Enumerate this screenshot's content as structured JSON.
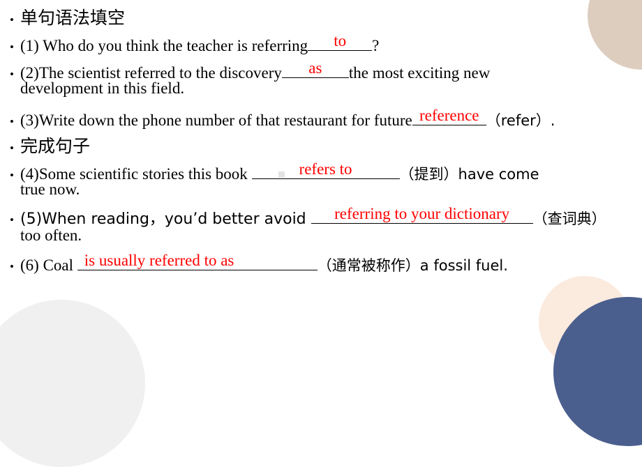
{
  "slide": {
    "background_color": "#ffffff",
    "answer_color": "#ff0000",
    "text_color": "#000000"
  },
  "decorations": [
    {
      "name": "circle-topright",
      "color": "#ddcdbf"
    },
    {
      "name": "circle-bottomleft",
      "color": "#f0f0f0"
    },
    {
      "name": "circle-peach",
      "color": "#fbeade"
    },
    {
      "name": "circle-navy",
      "color": "#4a5f8e"
    }
  ],
  "sections": {
    "heading1": "单句语法填空",
    "heading2": "完成句子"
  },
  "items": {
    "q1": {
      "number": "(1)",
      "text_before": " Who do you think the teacher is referring",
      "answer": "to",
      "text_after": "?"
    },
    "q2": {
      "number": "(2)",
      "text_before": "The scientist referred to the discovery",
      "answer": "as",
      "text_after": "the most exciting new",
      "line2": "development in this field."
    },
    "q3": {
      "number": "(3)",
      "text_before": "Write down the phone number of that restaurant for future",
      "answer": "reference",
      "text_after": "（refer）."
    },
    "q4": {
      "number": "(4)",
      "text_before": "Some scientific stories this book ",
      "answer": "refers to",
      "text_after": "（提到）have come",
      "line2": "true now."
    },
    "q5": {
      "number": "(5)",
      "text_before": "When reading，you’d better avoid ",
      "answer": "referring to your dictionary",
      "text_after": "（查词典）",
      "line2": "too often."
    },
    "q6": {
      "number": "(6)",
      "text_before": " Coal ",
      "answer": "is usually referred to as",
      "text_after": "（通常被称作）a fossil fuel."
    }
  }
}
